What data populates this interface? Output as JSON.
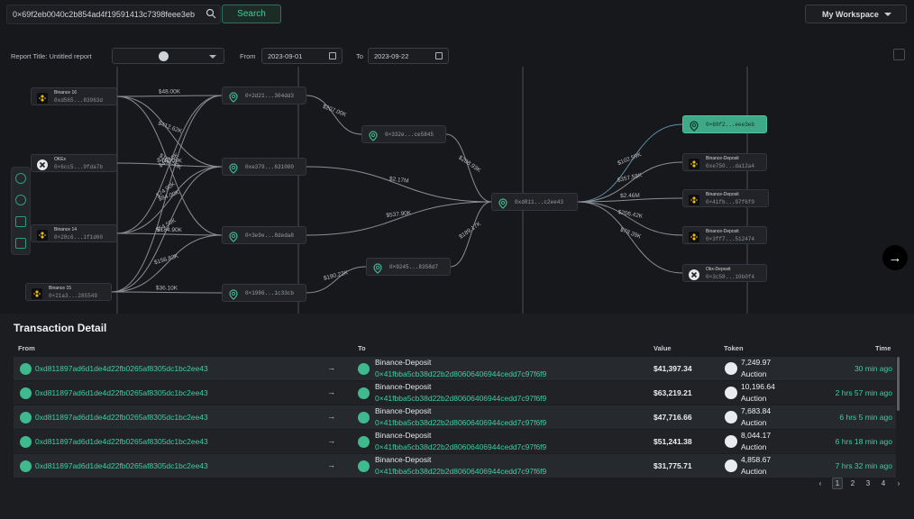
{
  "search": {
    "value": "0×69f2eb0040c2b854ad4f19591413c7398feee3eb",
    "button_label": "Search",
    "icon": "search-icon"
  },
  "workspace": {
    "label": "My Workspace"
  },
  "report": {
    "title": "Report Title: Untitled report",
    "from_label": "From",
    "from_date": "2023-09-01",
    "to_label": "To",
    "to_date": "2023-09-22"
  },
  "graph": {
    "nodes": [
      {
        "id": "n1",
        "label": "Binance 16",
        "addr": "0xd565...83963d",
        "icon": "binance-icon"
      },
      {
        "id": "n2",
        "label": "OKEx",
        "addr": "0×6cc5...9fda7b",
        "icon": "okex-icon"
      },
      {
        "id": "n3",
        "label": "Binance 14",
        "addr": "0×28c6...1f1d60",
        "icon": "binance-icon"
      },
      {
        "id": "n4",
        "label": "Binance 15",
        "addr": "0×21a3...285549",
        "icon": "binance-icon"
      },
      {
        "id": "n5",
        "addr": "0×2d21...304dd3",
        "icon": "address-icon"
      },
      {
        "id": "n6",
        "addr": "0xe379...631080",
        "icon": "address-icon"
      },
      {
        "id": "n7",
        "addr": "0×3e9e...8deda8",
        "icon": "address-icon"
      },
      {
        "id": "n8",
        "addr": "0×1986...1c33cb",
        "icon": "address-icon"
      },
      {
        "id": "n9",
        "addr": "0×332e...ce5845",
        "icon": "address-icon"
      },
      {
        "id": "n10",
        "addr": "0×9245...8358d7",
        "icon": "address-icon"
      },
      {
        "id": "n11",
        "addr": "0xd811...c2ee43",
        "icon": "address-icon"
      },
      {
        "id": "n12",
        "addr": "0×69f2...eee3eb",
        "icon": "address-icon"
      },
      {
        "id": "n13",
        "label": "Binance-Deposit",
        "addr": "0xe750...da12a4",
        "icon": "binance-icon"
      },
      {
        "id": "n14",
        "label": "Binance-Deposit",
        "addr": "0×41fb...97f6f9",
        "icon": "binance-icon"
      },
      {
        "id": "n15",
        "label": "Binance-Deposit",
        "addr": "0×3ff7...512474",
        "icon": "binance-icon"
      },
      {
        "id": "n16",
        "label": "Okx-Deposit",
        "addr": "0×3c58...10b0f4",
        "icon": "okex-icon"
      }
    ],
    "edges": [
      {
        "from": "n1",
        "to": "n5",
        "label": "$48.00K"
      },
      {
        "from": "n1",
        "to": "n6",
        "label": "$412.62K"
      },
      {
        "from": "n1",
        "to": "n7",
        "label": "$165.50K"
      },
      {
        "from": "n2",
        "to": "n6",
        "label": "$412.09K"
      },
      {
        "from": "n3",
        "to": "n6",
        "label": "$94.00K"
      },
      {
        "from": "n3",
        "to": "n7",
        "label": "$184.90K"
      },
      {
        "from": "n3",
        "to": "n5",
        "label": "$45.10K"
      },
      {
        "from": "n4",
        "to": "n5",
        "label": "$74.90K"
      },
      {
        "from": "n4",
        "to": "n6",
        "label": "$54.55K"
      },
      {
        "from": "n4",
        "to": "n7",
        "label": "$156.83K"
      },
      {
        "from": "n4",
        "to": "n8",
        "label": "$36.10K"
      },
      {
        "from": "n5",
        "to": "n9",
        "label": "$207.00K"
      },
      {
        "from": "n9",
        "to": "n11",
        "label": "$208.93K"
      },
      {
        "from": "n6",
        "to": "n11",
        "label": "$2.17M"
      },
      {
        "from": "n7",
        "to": "n11",
        "label": "$537.90K"
      },
      {
        "from": "n8",
        "to": "n10",
        "label": "$190.22K"
      },
      {
        "from": "n10",
        "to": "n11",
        "label": "$189.17K"
      },
      {
        "from": "n11",
        "to": "n12",
        "label": "$102.59K"
      },
      {
        "from": "n11",
        "to": "n13",
        "label": "$357.58K"
      },
      {
        "from": "n11",
        "to": "n14",
        "label": "$2.46M"
      },
      {
        "from": "n11",
        "to": "n15",
        "label": "$206.42K"
      },
      {
        "from": "n11",
        "to": "n16",
        "label": "$78.39K"
      }
    ]
  },
  "detail": {
    "title": "Transaction Detail",
    "headers": {
      "from": "From",
      "to": "To",
      "value": "Value",
      "token": "Token",
      "time": "Time"
    },
    "rows": [
      {
        "from": "0xd811897ad6d1de4d22fb0265af8305dc1bc2ee43",
        "to_name": "Binance-Deposit",
        "to_addr": "0×41fbba5cb38d22b2d80606406944cedd7c97f6f9",
        "value": "$41,397.34",
        "token_amount": "7,249.97",
        "token_name": "Auction",
        "time": "30 min ago"
      },
      {
        "from": "0xd811897ad6d1de4d22fb0265af8305dc1bc2ee43",
        "to_name": "Binance-Deposit",
        "to_addr": "0×41fbba5cb38d22b2d80606406944cedd7c97f6f9",
        "value": "$63,219.21",
        "token_amount": "10,196.64",
        "token_name": "Auction",
        "time": "2 hrs 57 min ago"
      },
      {
        "from": "0xd811897ad6d1de4d22fb0265af8305dc1bc2ee43",
        "to_name": "Binance-Deposit",
        "to_addr": "0×41fbba5cb38d22b2d80606406944cedd7c97f6f9",
        "value": "$47,716.66",
        "token_amount": "7,683.84",
        "token_name": "Auction",
        "time": "6 hrs 5 min ago"
      },
      {
        "from": "0xd811897ad6d1de4d22fb0265af8305dc1bc2ee43",
        "to_name": "Binance-Deposit",
        "to_addr": "0×41fbba5cb38d22b2d80606406944cedd7c97f6f9",
        "value": "$51,241.38",
        "token_amount": "8,044.17",
        "token_name": "Auction",
        "time": "6 hrs 18 min ago"
      },
      {
        "from": "0xd811897ad6d1de4d22fb0265af8305dc1bc2ee43",
        "to_name": "Binance-Deposit",
        "to_addr": "0×41fbba5cb38d22b2d80606406944cedd7c97f6f9",
        "value": "$31,775.71",
        "token_amount": "4,858.67",
        "token_name": "Auction",
        "time": "7 hrs 32 min ago"
      }
    ]
  },
  "pagination": {
    "pages": [
      "1",
      "2",
      "3",
      "4"
    ],
    "current": "1",
    "prev": "‹",
    "next": "›"
  },
  "colors": {
    "accent": "#3fcf9e",
    "highlight_node": "#3fa886",
    "background": "#17181b"
  }
}
